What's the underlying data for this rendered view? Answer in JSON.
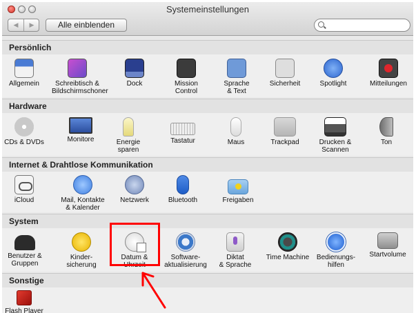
{
  "window": {
    "title": "Systemeinstellungen"
  },
  "toolbar": {
    "back": "◀",
    "forward": "▶",
    "show_all": "Alle einblenden",
    "search_value": "",
    "search_placeholder": ""
  },
  "sections": [
    {
      "title": "Persönlich",
      "items": [
        {
          "label": "Allgemein",
          "icon": "general-icon"
        },
        {
          "label": "Schreibtisch &\nBildschirmschoner",
          "icon": "desktop-screensaver-icon"
        },
        {
          "label": "Dock",
          "icon": "dock-icon"
        },
        {
          "label": "Mission\nControl",
          "icon": "mission-control-icon"
        },
        {
          "label": "Sprache\n& Text",
          "icon": "language-text-icon"
        },
        {
          "label": "Sicherheit",
          "icon": "security-icon"
        },
        {
          "label": "Spotlight",
          "icon": "spotlight-icon"
        },
        {
          "label": "Mitteilungen",
          "icon": "notifications-icon"
        }
      ]
    },
    {
      "title": "Hardware",
      "items": [
        {
          "label": "CDs & DVDs",
          "icon": "cd-dvd-icon"
        },
        {
          "label": "Monitore",
          "icon": "displays-icon"
        },
        {
          "label": "Energie\nsparen",
          "icon": "energy-saver-icon"
        },
        {
          "label": "Tastatur",
          "icon": "keyboard-icon"
        },
        {
          "label": "Maus",
          "icon": "mouse-icon"
        },
        {
          "label": "Trackpad",
          "icon": "trackpad-icon"
        },
        {
          "label": "Drucken &\nScannen",
          "icon": "printer-icon"
        },
        {
          "label": "Ton",
          "icon": "sound-icon"
        }
      ]
    },
    {
      "title": "Internet & Drahtlose Kommunikation",
      "items": [
        {
          "label": "iCloud",
          "icon": "icloud-icon"
        },
        {
          "label": "Mail, Kontakte\n& Kalender",
          "icon": "mail-contacts-calendar-icon"
        },
        {
          "label": "Netzwerk",
          "icon": "network-icon"
        },
        {
          "label": "Bluetooth",
          "icon": "bluetooth-icon"
        },
        {
          "label": "Freigaben",
          "icon": "sharing-icon"
        }
      ]
    },
    {
      "title": "System",
      "items": [
        {
          "label": "Benutzer &\nGruppen",
          "icon": "users-groups-icon"
        },
        {
          "label": "Kinder-\nsicherung",
          "icon": "parental-controls-icon"
        },
        {
          "label": "Datum &\nUhrzeit",
          "icon": "date-time-icon"
        },
        {
          "label": "Software-\naktualisierung",
          "icon": "software-update-icon"
        },
        {
          "label": "Diktat\n& Sprache",
          "icon": "dictation-speech-icon"
        },
        {
          "label": "Time Machine",
          "icon": "time-machine-icon"
        },
        {
          "label": "Bedienungs-\nhilfen",
          "icon": "accessibility-icon"
        },
        {
          "label": "Startvolume",
          "icon": "startup-disk-icon"
        }
      ]
    },
    {
      "title": "Sonstige",
      "items": [
        {
          "label": "Flash Player",
          "icon": "flash-player-icon"
        }
      ]
    }
  ],
  "highlight": {
    "color": "#ff0000",
    "target_label": "Datum & Uhrzeit"
  }
}
